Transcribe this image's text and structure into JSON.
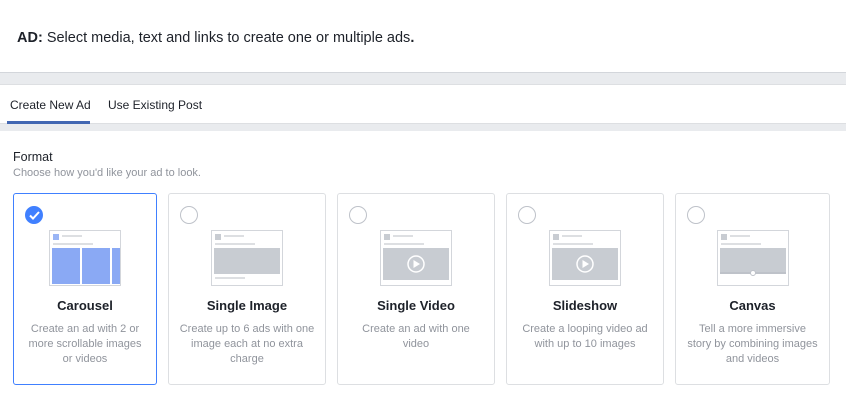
{
  "header": {
    "label": "AD:",
    "text": "Select media, text and links to create one or multiple ads",
    "tail": "."
  },
  "tabs": [
    {
      "label": "Create New Ad",
      "active": true
    },
    {
      "label": "Use Existing Post",
      "active": false
    }
  ],
  "format": {
    "title": "Format",
    "subtitle": "Choose how you'd like your ad to look.",
    "options": [
      {
        "title": "Carousel",
        "description": "Create an ad with 2 or more scrollable images or videos",
        "selected": true
      },
      {
        "title": "Single Image",
        "description": "Create up to 6 ads with one image each at no extra charge",
        "selected": false
      },
      {
        "title": "Single Video",
        "description": "Create an ad with one video",
        "selected": false
      },
      {
        "title": "Slideshow",
        "description": "Create a looping video ad with up to 10 images",
        "selected": false
      },
      {
        "title": "Canvas",
        "description": "Tell a more immersive story by combining images and videos",
        "selected": false
      }
    ]
  },
  "colors": {
    "accent": "#4080ff",
    "tab_underline": "#4267b2",
    "muted_text": "#90949c"
  }
}
